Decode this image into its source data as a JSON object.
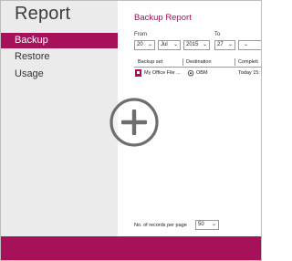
{
  "app": {
    "title": "Report"
  },
  "sidebar": {
    "items": [
      {
        "label": "Backup",
        "active": true
      },
      {
        "label": "Restore",
        "active": false
      },
      {
        "label": "Usage",
        "active": false
      }
    ]
  },
  "main": {
    "title": "Backup Report",
    "from_label": "From",
    "to_label": "To",
    "from": {
      "day": "20",
      "month": "Jul",
      "year": "2015"
    },
    "to": {
      "day": "27"
    },
    "table": {
      "columns": [
        "Backup set",
        "Destination",
        "Completi"
      ],
      "rows": [
        {
          "backup_set": "My Office File ...",
          "destination": "OBM",
          "completion": "Today 15:"
        }
      ]
    },
    "records_per_page_label": "No. of records per page",
    "records_per_page_value": "50"
  },
  "overlay": {
    "icon": "plus-circle-icon"
  },
  "colors": {
    "accent": "#a6125a",
    "sidebar_bg": "#ebebeb"
  }
}
